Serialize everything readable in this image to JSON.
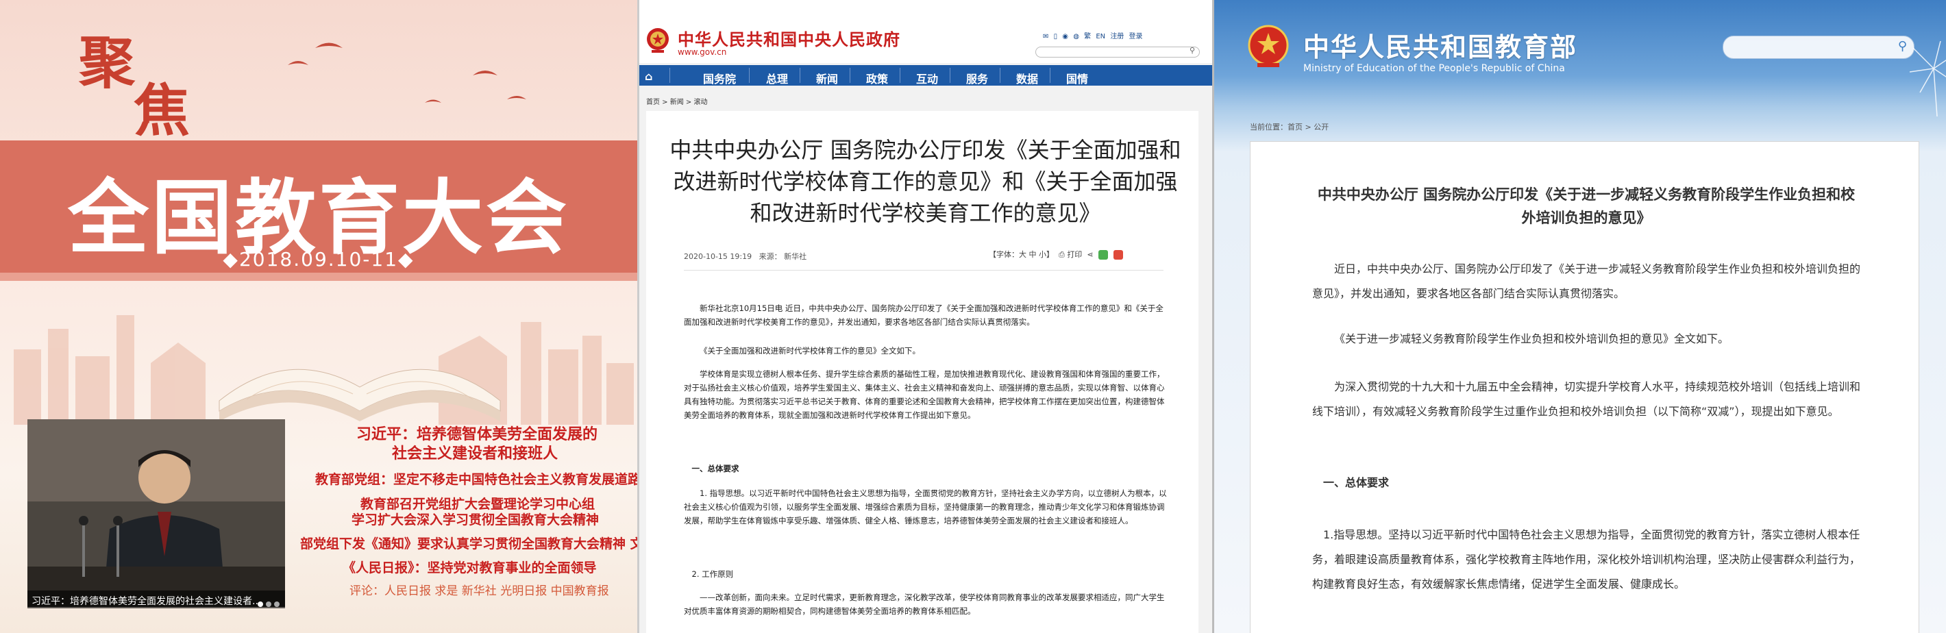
{
  "panel1": {
    "jujiao_chars": [
      "聚",
      "焦"
    ],
    "main_title": "全国教育大会",
    "date": "2018.09.10-11",
    "photo_caption": "习近平：培养德智体美劳全面发展的社会主义建设者...",
    "headlines": [
      "习近平：培养德智体美劳全面发展的",
      "社会主义建设者和接班人",
      "教育部党组：坚定不移走中国特色社会主义教育发展道路",
      "教育部召开党组扩大会暨理论学习中心组",
      "学习扩大会深入学习贯彻全国教育大会精神",
      "部党组下发《通知》要求认真学习贯彻全国教育大会精神 文件",
      "《人民日报》：坚持党对教育事业的全面领导"
    ],
    "comment": "评论：人民日报 求是 新华社 光明日报 中国教育报",
    "colors": {
      "band": "#d9705f",
      "headline": "#c8201f"
    }
  },
  "panel2": {
    "site_title": "中华人民共和国中央人民政府",
    "site_url": "www.gov.cn",
    "top_links": [
      "繁",
      "EN",
      "注册",
      "登录"
    ],
    "nav": [
      "国务院",
      "总理",
      "新闻",
      "政策",
      "互动",
      "服务",
      "数据",
      "国情"
    ],
    "breadcrumb": "首页 > 新闻 > 滚动",
    "article_title": "中共中央办公厅 国务院办公厅印发《关于全面加强和改进新时代学校体育工作的意见》和《关于全面加强和改进新时代学校美育工作的意见》",
    "date": "2020-10-15 19:19",
    "source": "来源：  新华社",
    "font_tool": "【字体：大 中 小】",
    "print": "打印",
    "paragraphs": [
      "新华社北京10月15日电 近日，中共中央办公厅、国务院办公厅印发了《关于全面加强和改进新时代学校体育工作的意见》和《关于全面加强和改进新时代学校美育工作的意见》，并发出通知，要求各地区各部门结合实际认真贯彻落实。",
      "《关于全面加强和改进新时代学校体育工作的意见》全文如下。",
      "学校体育是实现立德树人根本任务、提升学生综合素质的基础性工程，是加快推进教育现代化、建设教育强国和体育强国的重要工作，对于弘扬社会主义核心价值观，培养学生爱国主义、集体主义、社会主义精神和奋发向上、顽强拼搏的意志品质，实现以体育智、以体育心具有独特功能。为贯彻落实习近平总书记关于教育、体育的重要论述和全国教育大会精神，把学校体育工作摆在更加突出位置，构建德智体美劳全面培养的教育体系，现就全面加强和改进新时代学校体育工作提出如下意见。",
      "一、总体要求",
      "1. 指导思想。以习近平新时代中国特色社会主义思想为指导，全面贯彻党的教育方针，坚持社会主义办学方向，以立德树人为根本，以社会主义核心价值观为引领，以服务学生全面发展、增强综合素质为目标，坚持健康第一的教育理念，推动青少年文化学习和体育锻炼协调发展，帮助学生在体育锻炼中享受乐趣、增强体质、健全人格、锤炼意志，培养德智体美劳全面发展的社会主义建设者和接班人。",
      "2. 工作原则",
      "——改革创新，面向未来。立足时代需求，更新教育理念，深化教学改革，使学校体育同教育事业的改革发展要求相适应，同广大学生对优质丰富体育资源的期盼相契合，同构建德智体美劳全面培养的教育体系相匹配。"
    ]
  },
  "panel3": {
    "title": "中华人民共和国教育部",
    "title_en": "Ministry of Education of the People's Republic of China",
    "breadcrumb": "当前位置：首页 > 公开",
    "article_title": "中共中央办公厅 国务院办公厅印发《关于进一步减轻义务教育阶段学生作业负担和校外培训负担的意见》",
    "paragraphs": [
      "近日，中共中央办公厅、国务院办公厅印发了《关于进一步减轻义务教育阶段学生作业负担和校外培训负担的意见》，并发出通知，要求各地区各部门结合实际认真贯彻落实。",
      "《关于进一步减轻义务教育阶段学生作业负担和校外培训负担的意见》全文如下。",
      "为深入贯彻党的十九大和十九届五中全会精神，切实提升学校育人水平，持续规范校外培训（包括线上培训和线下培训），有效减轻义务教育阶段学生过重作业负担和校外培训负担（以下简称“双减”），现提出如下意见。",
      "一、总体要求",
      "1.指导思想。坚持以习近平新时代中国特色社会主义思想为指导，全面贯彻党的教育方针，落实立德树人根本任务，着眼建设高质量教育体系，强化学校教育主阵地作用，深化校外培训机构治理，坚决防止侵害群众利益行为，构建教育良好生态，有效缓解家长焦虑情绪，促进学生全面发展、健康成长。"
    ]
  }
}
